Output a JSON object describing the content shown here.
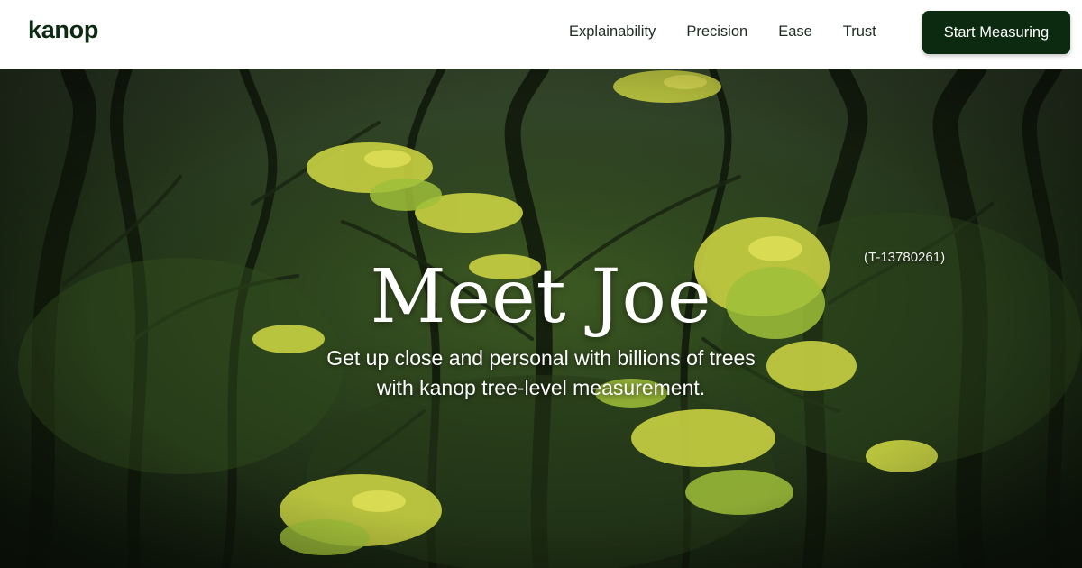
{
  "brand": {
    "logo_text": "kanop",
    "color": "#0d2a12"
  },
  "nav": {
    "links": [
      {
        "label": "Explainability"
      },
      {
        "label": "Precision"
      },
      {
        "label": "Ease"
      },
      {
        "label": "Trust"
      }
    ],
    "cta_label": "Start Measuring",
    "cta_color": "#0b2a10"
  },
  "hero": {
    "title": "Meet Joe",
    "tree_id": "(T-13780261)",
    "subtitle_line1": "Get up close and personal with billions of trees",
    "subtitle_line2": "with kanop tree-level measurement.",
    "background": "forest-photo",
    "colors": {
      "dark_forest": "#1b2a13",
      "leaf_yellow": "#cfd64a",
      "leaf_green": "#9fbf3a"
    }
  }
}
